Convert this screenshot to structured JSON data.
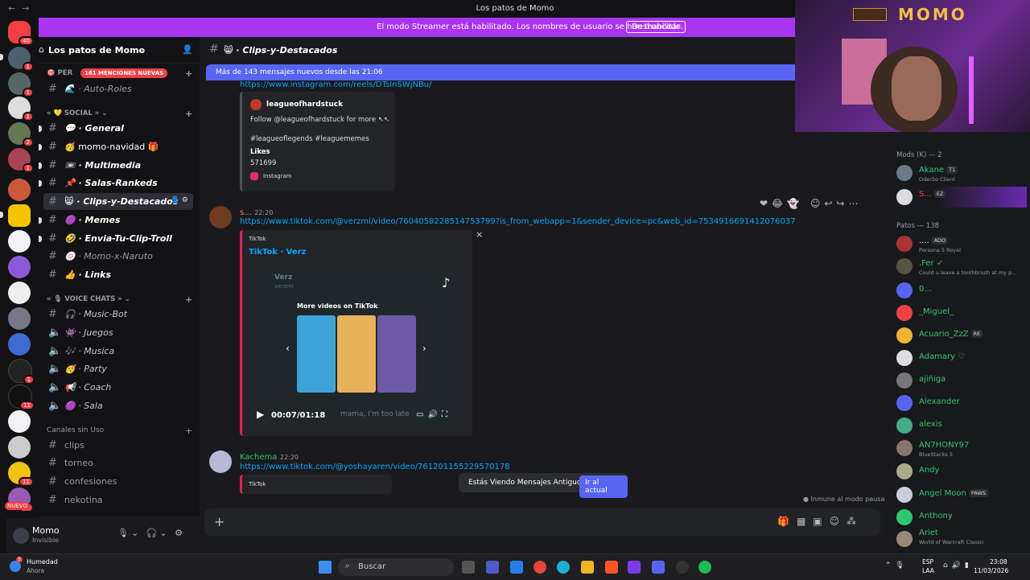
{
  "window": {
    "title": "Los patos de Momo"
  },
  "streamer_banner": {
    "message": "El modo Streamer está habilitado. Los nombres de usuario se han truncado.",
    "button": "Deshabilitar"
  },
  "server_badges": [
    "40",
    "1",
    "1",
    "1",
    "2",
    "1",
    "1",
    "11",
    "11",
    "29"
  ],
  "new_label": "NUEVO",
  "server": {
    "name": "Los patos de Momo"
  },
  "mentions_pill": "161 MENCIONES NUEVAS",
  "categories": {
    "first": "PER",
    "social": "SOCIAL",
    "voice": "VOICE CHATS",
    "unused": "Canales sin Uso"
  },
  "channels": [
    "Auto-Roles",
    "General",
    "momo-navidad",
    "Multimedia",
    "Salas-Rankeds",
    "Clips-y-Destacados",
    "Memes",
    "Envia-Tu-Clip-Troll",
    "Momo-x-Naruto",
    "Links"
  ],
  "voice_channels": [
    "Music-Bot",
    "Juegos",
    "Musica",
    "Party",
    "Coach",
    "Sala"
  ],
  "unused_channels": [
    "clips",
    "torneo",
    "confesiones",
    "nekotina"
  ],
  "current_user": {
    "name": "Momo",
    "status": "Invisible"
  },
  "header": {
    "channel": "Clips-y-Destacados"
  },
  "new_messages_bar": "Más de 143 mensajes nuevos desde las 21:06",
  "messages": {
    "top_link": "https://www.instagram.com/reels/DTsInSWjNBu/",
    "instagram_embed": {
      "account": "leagueofhardstuck",
      "text1": "Follow @leagueofhardstuck for more ",
      "text2": "#leagueoflegends #leaguememes",
      "likes_label": "Likes",
      "likes_value": "571699",
      "provider": "Instagram"
    },
    "msg2": {
      "author": "s...",
      "time": "22:20",
      "link": "https://www.tiktok.com/@verzmi/video/7604058228514753799?is_from_webapp=1&sender_device=pc&web_id=7534916691412076037"
    },
    "tiktok_embed": {
      "provider": "TikTok",
      "title": "TikTok · Verz",
      "more": "More videos on TikTok",
      "time": "00:07/01:18",
      "caption": "mama, I'm too late",
      "creator": "Verz",
      "creator_handle": "verzmi"
    },
    "msg3": {
      "author": "Kachema",
      "time": "22:20",
      "link": "https://www.tiktok.com/@yoshayaren/video/761201155229570178",
      "provider": "TikTok"
    }
  },
  "old_messages": {
    "text": "Estás Viendo Mensajes Antiguos",
    "button": "Ir al actual"
  },
  "paused_note": "Inmune al modo pausado",
  "members": {
    "mods_header": "Mods (K) — 2",
    "mods": [
      {
        "name": "Akane",
        "sub": "OderSo Client",
        "tag": "T1"
      },
      {
        "name": "S...",
        "tag": "EZ"
      }
    ],
    "patos_header": "Patos — 138",
    "patos": [
      {
        "name": "....",
        "sub": "Persona 5 Royal",
        "tag": "ADO"
      },
      {
        "name": ".Fer ✓",
        "sub": "Could u leave a toothbrush at my p..."
      },
      {
        "name": "0..."
      },
      {
        "name": "_Miguel_"
      },
      {
        "name": "Acuario_ZzZ",
        "tag": "RE"
      },
      {
        "name": "Adamary ♡"
      },
      {
        "name": "ajiñiga"
      },
      {
        "name": "Alexander"
      },
      {
        "name": "alexis"
      },
      {
        "name": "AN7HONY97",
        "sub": "BlueStacks 5"
      },
      {
        "name": "Andy"
      },
      {
        "name": "Angel Moon",
        "tag": "PAWS"
      },
      {
        "name": "Anthony"
      },
      {
        "name": "Ariet",
        "sub": "World of Warcraft Classic"
      }
    ]
  },
  "webcam": {
    "sign": "MOMO"
  },
  "taskbar": {
    "weather": "Humedad",
    "weather_sub": "Ahora",
    "weather_badge": "3",
    "search": "Buscar",
    "lang": "ESP",
    "lang2": "LAA",
    "time": "23:08",
    "date": "11/03/2026"
  }
}
